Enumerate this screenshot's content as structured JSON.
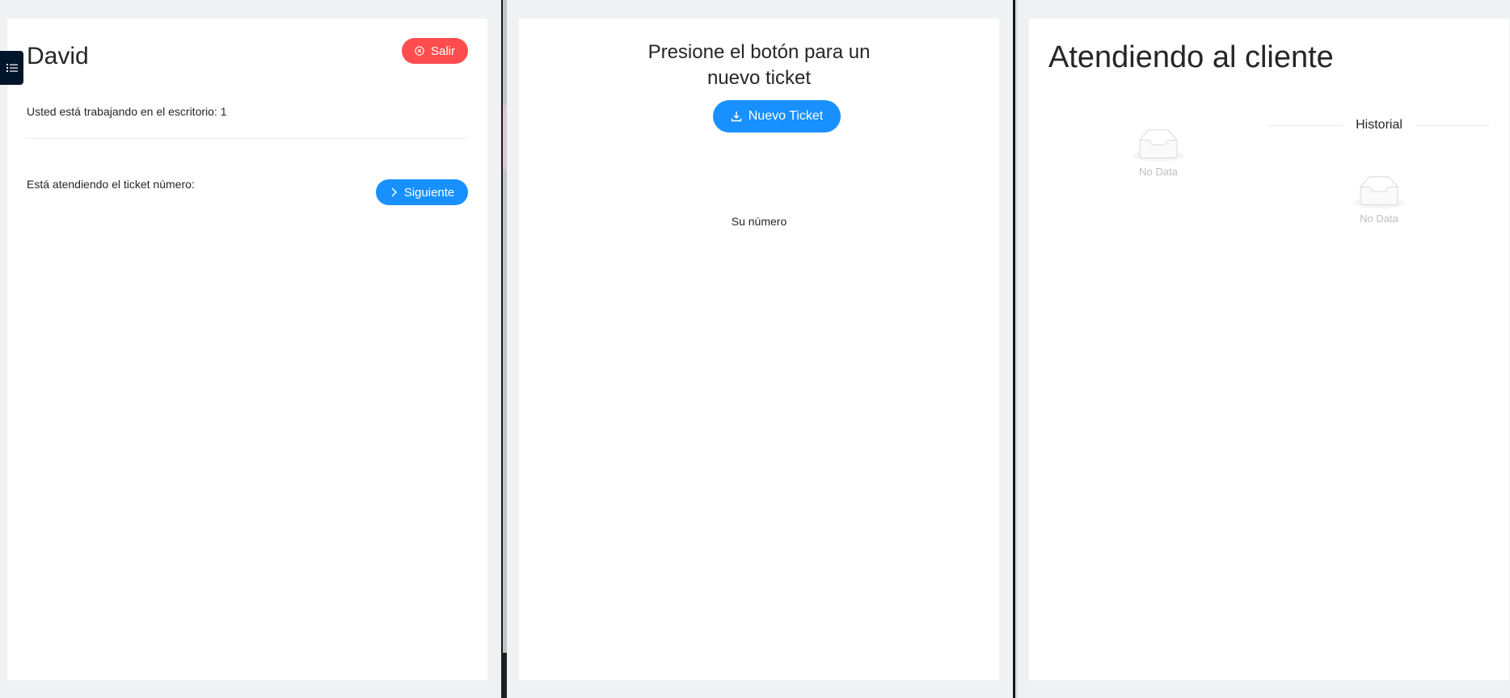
{
  "colors": {
    "primary": "#1890ff",
    "danger": "#ff4d4f",
    "sider": "#001529",
    "background": "#f0f1f3"
  },
  "escritorio": {
    "agent_name": "David",
    "exit_button": "Salir",
    "exit_icon": "close-circle-icon",
    "workstation_text": "Usted está trabajando en el escritorio: 1",
    "ticket_text": "Está atendiendo el ticket número:",
    "next_button": "Siguiente",
    "next_icon": "chevron-right-icon",
    "menu_icon": "unordered-list-icon"
  },
  "crear_ticket": {
    "title_line1": "Presione el botón para un",
    "title_line2": "nuevo ticket",
    "new_button": "Nuevo Ticket",
    "new_icon": "download-icon",
    "number_label": "Su número"
  },
  "cola": {
    "title": "Atendiendo al cliente",
    "history_label": "Historial",
    "empty_text_left": "No Data",
    "empty_text_right": "No Data"
  }
}
